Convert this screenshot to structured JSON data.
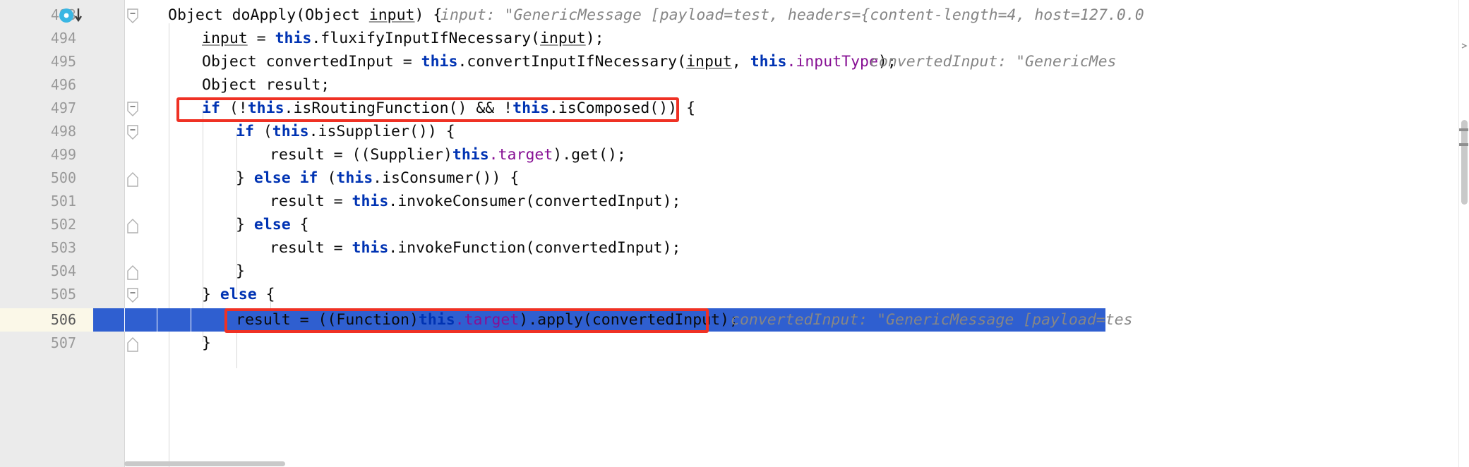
{
  "app": {
    "kind": "ide-code-editor-debugger",
    "language": "java",
    "colors": {
      "keyword": "#0033b3",
      "field": "#871094",
      "inlay_hint": "#868686",
      "selection": "#2f5fd0",
      "annotation_box": "#ef3124",
      "gutter_bg": "#ebebeb",
      "current_line_gutter": "#fbf8e8"
    }
  },
  "editor": {
    "current_line_number": "506",
    "execution_pointer_line": "493",
    "lines": [
      {
        "number": "493",
        "indent": 1,
        "text": "Object doApply(Object input) {",
        "inlay": "input: \"GenericMessage [payload=test, headers={content-length=4, host=127.0.0",
        "has_fold": true,
        "has_exec_marker": true
      },
      {
        "number": "494",
        "indent": 2,
        "text": "input = this.fluxifyInputIfNecessary(input);",
        "inlay": "",
        "has_fold": false,
        "has_exec_marker": false
      },
      {
        "number": "495",
        "indent": 2,
        "text": "Object convertedInput = this.convertInputIfNecessary(input, this.inputType);",
        "inlay": "convertedInput: \"GenericMes",
        "has_fold": false,
        "has_exec_marker": false
      },
      {
        "number": "496",
        "indent": 2,
        "text": "Object result;",
        "inlay": "",
        "has_fold": false,
        "has_exec_marker": false
      },
      {
        "number": "497",
        "indent": 2,
        "text": "if (!this.isRoutingFunction() && !this.isComposed()) {",
        "inlay": "",
        "has_fold": true,
        "has_exec_marker": false
      },
      {
        "number": "498",
        "indent": 3,
        "text": "if (this.isSupplier()) {",
        "inlay": "",
        "has_fold": true,
        "has_exec_marker": false
      },
      {
        "number": "499",
        "indent": 4,
        "text": "result = ((Supplier)this.target).get();",
        "inlay": "",
        "has_fold": false,
        "has_exec_marker": false
      },
      {
        "number": "500",
        "indent": 3,
        "text": "} else if (this.isConsumer()) {",
        "inlay": "",
        "has_fold": true,
        "has_exec_marker": false
      },
      {
        "number": "501",
        "indent": 4,
        "text": "result = this.invokeConsumer(convertedInput);",
        "inlay": "",
        "has_fold": false,
        "has_exec_marker": false
      },
      {
        "number": "502",
        "indent": 3,
        "text": "} else {",
        "inlay": "",
        "has_fold": true,
        "has_exec_marker": false
      },
      {
        "number": "503",
        "indent": 4,
        "text": "result = this.invokeFunction(convertedInput);",
        "inlay": "",
        "has_fold": false,
        "has_exec_marker": false
      },
      {
        "number": "504",
        "indent": 3,
        "text": "}",
        "inlay": "",
        "has_fold": true,
        "has_exec_marker": false
      },
      {
        "number": "505",
        "indent": 2,
        "text": "} else {",
        "inlay": "",
        "has_fold": true,
        "has_exec_marker": false
      },
      {
        "number": "506",
        "indent": 3,
        "text": "result = ((Function)this.target).apply(convertedInput);",
        "inlay": "convertedInput: \"GenericMessage [payload=tes",
        "has_fold": false,
        "has_exec_marker": false
      },
      {
        "number": "507",
        "indent": 2,
        "text": "}",
        "inlay": "",
        "has_fold": true,
        "has_exec_marker": false
      }
    ],
    "annotations": [
      {
        "name": "highlight-if-routing-function",
        "target_line": "497"
      },
      {
        "name": "highlight-apply-call",
        "target_line": "506"
      }
    ]
  }
}
